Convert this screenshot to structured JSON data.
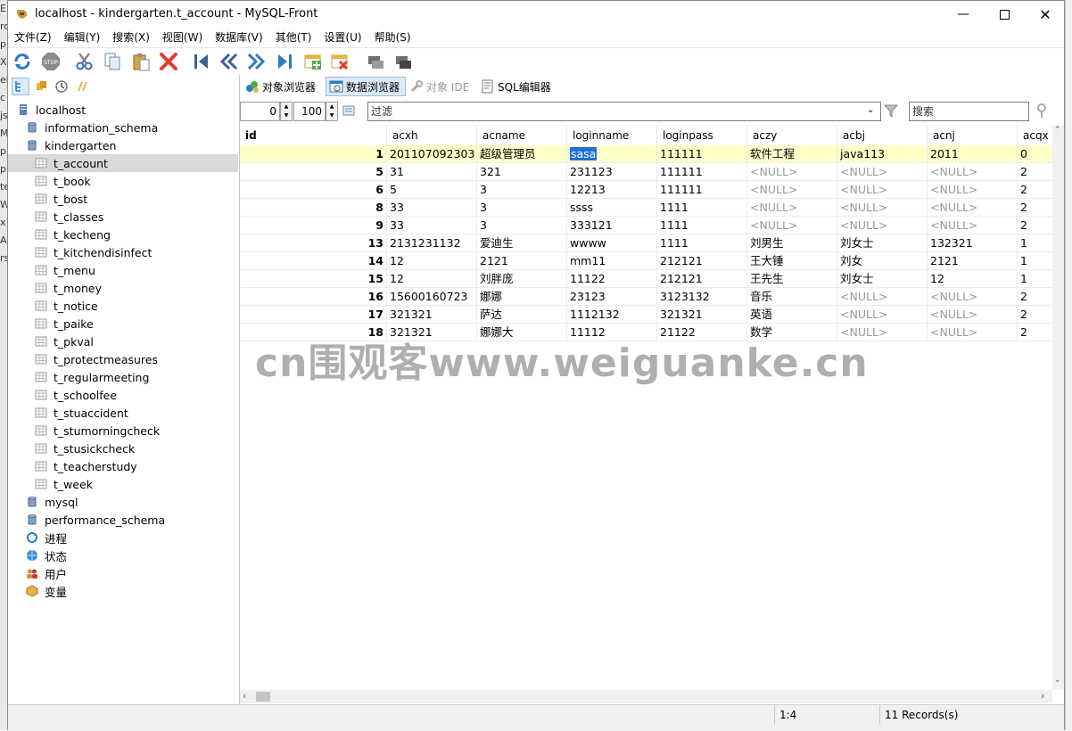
{
  "window": {
    "title": "localhost - kindergarten.t_account - MySQL-Front"
  },
  "bg_strip": [
    "Ex",
    "rc",
    "p",
    "X-",
    "",
    "eb",
    "c",
    "js",
    "M",
    "p",
    "p",
    "te",
    "W",
    "",
    "",
    "x",
    "",
    "A",
    "rs"
  ],
  "menu": [
    "文件(Z)",
    "编辑(Y)",
    "搜索(X)",
    "视图(W)",
    "数据库(V)",
    "其他(T)",
    "设置(U)",
    "帮助(S)"
  ],
  "toolbar_icons": [
    "refresh-icon",
    "stop-icon",
    "cut-icon",
    "copy-icon",
    "paste-icon",
    "delete-icon",
    "first-record-icon",
    "previous-page-icon",
    "next-page-icon",
    "last-record-icon",
    "insert-record-icon",
    "delete-record-icon",
    "post-record-icon",
    "cancel-record-icon"
  ],
  "main_tabs": {
    "object_browser": "对象浏览器",
    "data_browser": "数据浏览器",
    "object_ide": "对象 IDE",
    "sql_editor": "SQL编辑器"
  },
  "filter": {
    "offset": "0",
    "limit": "100",
    "filter_placeholder": "过滤",
    "search_placeholder": "搜索"
  },
  "tree": [
    {
      "label": "localhost",
      "level": 0,
      "icon": "server-icon"
    },
    {
      "label": "information_schema",
      "level": 1,
      "icon": "database-icon"
    },
    {
      "label": "kindergarten",
      "level": 1,
      "icon": "database-icon"
    },
    {
      "label": "t_account",
      "level": 2,
      "icon": "table-icon",
      "selected": true
    },
    {
      "label": "t_book",
      "level": 2,
      "icon": "table-icon"
    },
    {
      "label": "t_bost",
      "level": 2,
      "icon": "table-icon"
    },
    {
      "label": "t_classes",
      "level": 2,
      "icon": "table-icon"
    },
    {
      "label": "t_kecheng",
      "level": 2,
      "icon": "table-icon"
    },
    {
      "label": "t_kitchendisinfect",
      "level": 2,
      "icon": "table-icon"
    },
    {
      "label": "t_menu",
      "level": 2,
      "icon": "table-icon"
    },
    {
      "label": "t_money",
      "level": 2,
      "icon": "table-icon"
    },
    {
      "label": "t_notice",
      "level": 2,
      "icon": "table-icon"
    },
    {
      "label": "t_paike",
      "level": 2,
      "icon": "table-icon"
    },
    {
      "label": "t_pkval",
      "level": 2,
      "icon": "table-icon"
    },
    {
      "label": "t_protectmeasures",
      "level": 2,
      "icon": "table-icon"
    },
    {
      "label": "t_regularmeeting",
      "level": 2,
      "icon": "table-icon"
    },
    {
      "label": "t_schoolfee",
      "level": 2,
      "icon": "table-icon"
    },
    {
      "label": "t_stuaccident",
      "level": 2,
      "icon": "table-icon"
    },
    {
      "label": "t_stumorningcheck",
      "level": 2,
      "icon": "table-icon"
    },
    {
      "label": "t_stusickcheck",
      "level": 2,
      "icon": "table-icon"
    },
    {
      "label": "t_teacherstudy",
      "level": 2,
      "icon": "table-icon"
    },
    {
      "label": "t_week",
      "level": 2,
      "icon": "table-icon"
    },
    {
      "label": "mysql",
      "level": 1,
      "icon": "database-icon"
    },
    {
      "label": "performance_schema",
      "level": 1,
      "icon": "database-icon"
    },
    {
      "label": "进程",
      "level": 1,
      "icon": "process-icon"
    },
    {
      "label": "状态",
      "level": 1,
      "icon": "status-icon"
    },
    {
      "label": "用户",
      "level": 1,
      "icon": "users-icon"
    },
    {
      "label": "变量",
      "level": 1,
      "icon": "variables-icon"
    }
  ],
  "grid": {
    "columns": [
      "id",
      "acxh",
      "acname",
      "loginname",
      "loginpass",
      "aczy",
      "acbj",
      "acnj",
      "acqx"
    ],
    "rows": [
      [
        "1",
        "201107092303",
        "超级管理员",
        "sasa",
        "111111",
        "软件工程",
        "java113",
        "2011",
        "0"
      ],
      [
        "5",
        "31",
        "321",
        "231123",
        "111111",
        "<NULL>",
        "<NULL>",
        "<NULL>",
        "2"
      ],
      [
        "6",
        "5",
        "3",
        "12213",
        "111111",
        "<NULL>",
        "<NULL>",
        "<NULL>",
        "2"
      ],
      [
        "8",
        "33",
        "3",
        "ssss",
        "1111",
        "<NULL>",
        "<NULL>",
        "<NULL>",
        "2"
      ],
      [
        "9",
        "33",
        "3",
        "333121",
        "1111",
        "<NULL>",
        "<NULL>",
        "<NULL>",
        "2"
      ],
      [
        "13",
        "2131231132",
        "爱迪生",
        "wwww",
        "1111",
        "刘男生",
        "刘女士",
        "132321",
        "1"
      ],
      [
        "14",
        "12",
        "2121",
        "mm11",
        "212121",
        "王大锤",
        "刘女",
        "2121",
        "1"
      ],
      [
        "15",
        "12",
        "刘胖庞",
        "11122",
        "212121",
        "王先生",
        "刘女士",
        "12",
        "1"
      ],
      [
        "16",
        "15600160723",
        "娜娜",
        "23123",
        "3123132",
        "音乐",
        "<NULL>",
        "<NULL>",
        "2"
      ],
      [
        "17",
        "321321",
        "萨达",
        "1112132",
        "321321",
        "英语",
        "<NULL>",
        "<NULL>",
        "2"
      ],
      [
        "18",
        "321321",
        "娜娜大",
        "11112",
        "21122",
        "数学",
        "<NULL>",
        "<NULL>",
        "2"
      ]
    ]
  },
  "status": {
    "position": "1:4",
    "records": "11 Records(s)"
  },
  "watermark": "cn围观客www.weiguanke.cn"
}
